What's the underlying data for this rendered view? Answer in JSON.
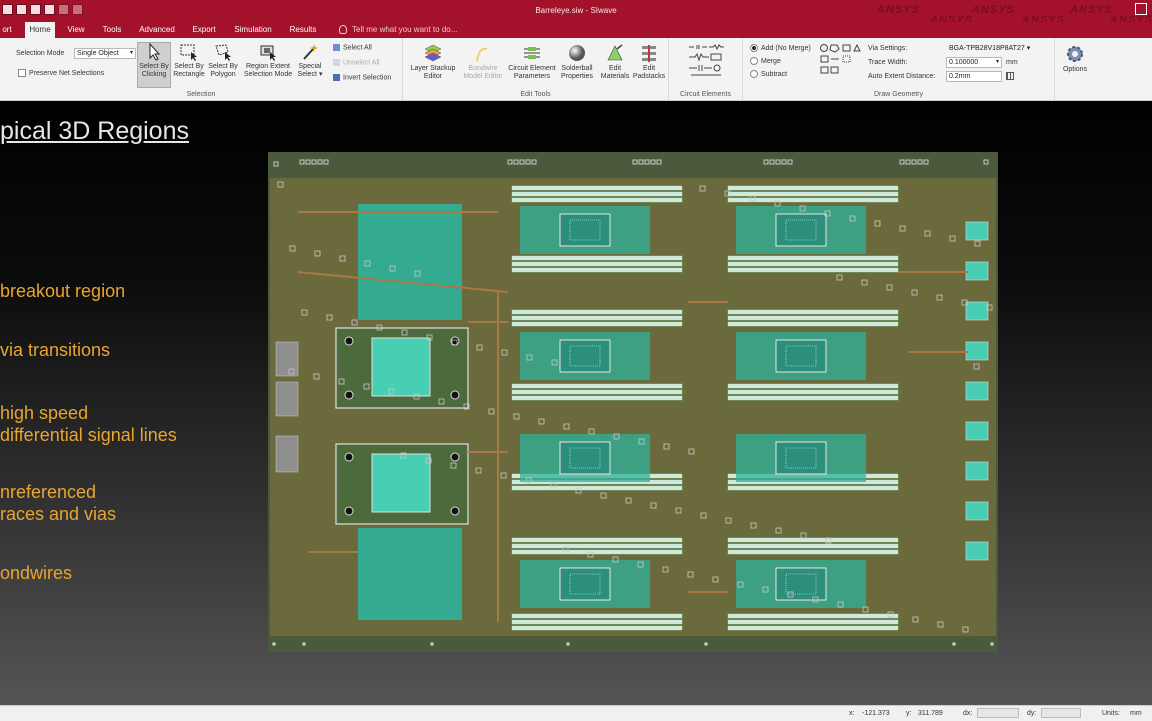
{
  "window": {
    "title": "Barreleye.siw - SIwave",
    "watermark": "ANSYS"
  },
  "tabs": [
    {
      "label": "ort"
    },
    {
      "label": "Home",
      "active": true
    },
    {
      "label": "View"
    },
    {
      "label": "Tools"
    },
    {
      "label": "Advanced"
    },
    {
      "label": "Export"
    },
    {
      "label": "Simulation"
    },
    {
      "label": "Results"
    }
  ],
  "tell_me": "Tell me what you want to do...",
  "ribbon": {
    "selection": {
      "group_label": "Selection",
      "mode_label": "Selection Mode",
      "mode_value": "Single Object",
      "preserve_label": "Preserve Net Selections",
      "buttons": {
        "by_clicking": [
          "Select By",
          "Clicking"
        ],
        "by_rectangle": [
          "Select By",
          "Rectangle"
        ],
        "by_polygon": [
          "Select By",
          "Polygon"
        ],
        "region_extent": [
          "Region Extent",
          "Selection Mode"
        ],
        "special": [
          "Special",
          "Select"
        ]
      },
      "select_all": "Select All",
      "unselect_all": "Unselect All",
      "invert_selection": "Invert Selection"
    },
    "edit_tools": {
      "group_label": "Edit Tools",
      "buttons": {
        "layer_stackup": [
          "Layer Stackup",
          "Editor"
        ],
        "bondwire": [
          "Bondwire",
          "Model Editor"
        ],
        "circuit_element": [
          "Circuit Element",
          "Parameters"
        ],
        "solderball": [
          "Solderball",
          "Properties"
        ],
        "edit_materials": [
          "Edit",
          "Materials"
        ],
        "edit_padstacks": [
          "Edit",
          "Padstacks"
        ]
      }
    },
    "circuit_elements": {
      "group_label": "Circuit Elements"
    },
    "draw_geometry": {
      "group_label": "Draw Geometry",
      "add_no_merge": "Add (No Merge)",
      "merge": "Merge",
      "subtract": "Subtract",
      "via_settings_label": "Via Settings:",
      "via_settings_value": "BGA-TPB28V18P8AT27",
      "trace_width_label": "Trace Width:",
      "trace_width_value": "0.100000",
      "trace_width_unit": "mm",
      "auto_extent_label": "Auto Extent Distance:",
      "auto_extent_value": "0.2mm"
    },
    "options": {
      "label": "Options"
    }
  },
  "slide": {
    "title": "pical 3D Regions",
    "bullets": [
      {
        "lines": [
          "breakout region"
        ]
      },
      {
        "lines": [
          "via transitions"
        ]
      },
      {
        "lines": [
          "high speed",
          "differential signal lines"
        ]
      },
      {
        "lines": [
          "nreferenced",
          "races and vias"
        ]
      },
      {
        "lines": [
          "ondwires"
        ]
      }
    ]
  },
  "board": {
    "colors": {
      "outer": "#4a5a3a",
      "substrate": "#6b6a3c",
      "copper": "#2fb39a",
      "copper_light": "#48cfb3",
      "pad": "#c8c8c8",
      "trace": "#a87845"
    }
  },
  "statusbar": {
    "x_label": "x:",
    "x_value": "-121.373",
    "y_label": "y:",
    "y_value": "311.789",
    "dx_label": "dx:",
    "dy_label": "dy:",
    "units_label": "Units:",
    "units_value": "mm"
  }
}
